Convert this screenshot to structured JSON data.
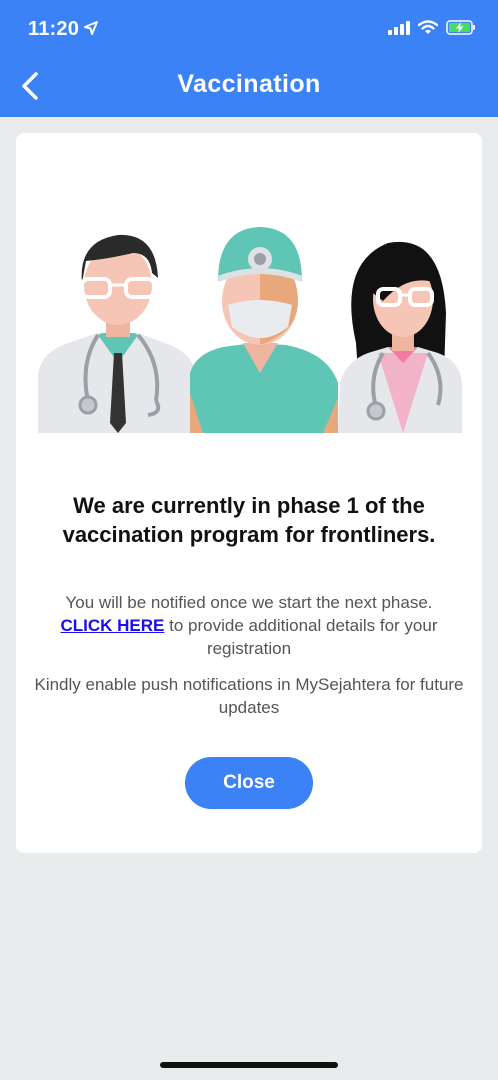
{
  "status_bar": {
    "time": "11:20"
  },
  "header": {
    "title": "Vaccination",
    "back_icon": "chevron-left-icon"
  },
  "card": {
    "headline": "We are currently in phase 1 of the vaccination program for frontliners.",
    "notice_before_link": "You will be notified once we start the next phase.",
    "link_label": "CLICK HERE",
    "notice_after_link": " to provide additional details for your registration",
    "push_notice": "Kindly enable push notifications in MySejahtera for future updates",
    "close_label": "Close"
  },
  "colors": {
    "accent": "#3b82f6",
    "background": "#e9eced",
    "link": "#1a0dee"
  }
}
